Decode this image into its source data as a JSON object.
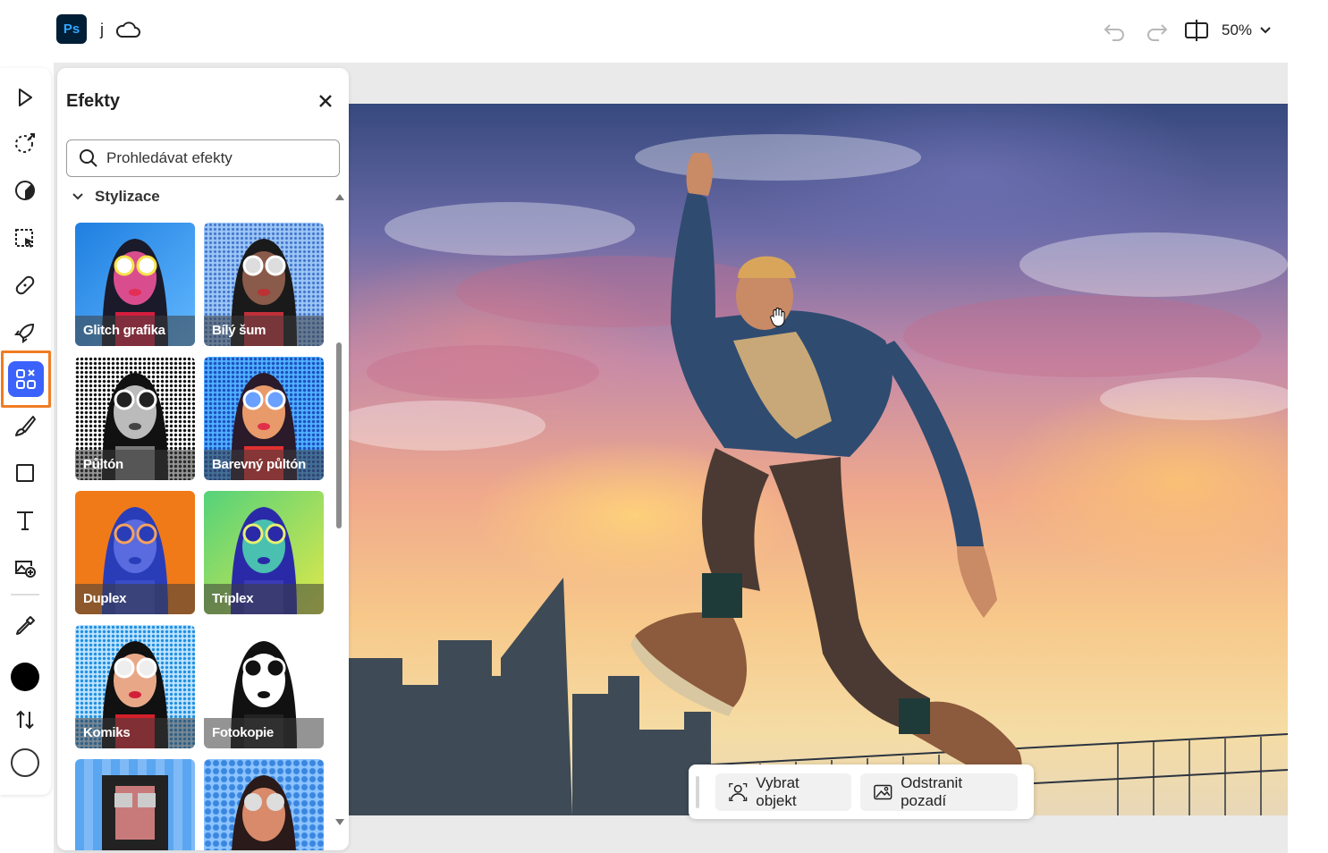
{
  "app": {
    "logo": "Ps",
    "document_name": "j"
  },
  "topbar": {
    "zoom": "50%"
  },
  "panel": {
    "title": "Efekty",
    "search_placeholder": "Prohledávat efekty",
    "section": "Stylizace",
    "effects": [
      {
        "label": "Glitch grafika"
      },
      {
        "label": "Bílý šum"
      },
      {
        "label": "Půltón"
      },
      {
        "label": "Barevný půltón"
      },
      {
        "label": "Duplex"
      },
      {
        "label": "Triplex"
      },
      {
        "label": "Komiks"
      },
      {
        "label": "Fotokopie"
      },
      {
        "label": ""
      },
      {
        "label": ""
      }
    ]
  },
  "action_bar": {
    "select_subject": "Vybrat objekt",
    "remove_background": "Odstranit pozadí"
  },
  "toolbar": {
    "tools": [
      "move-tool",
      "quick-select-tool",
      "adjust-tool",
      "selection-tool",
      "heal-tool",
      "quick-actions-tool",
      "effects-tool",
      "brush-tool",
      "shape-tool",
      "text-tool",
      "add-image-tool",
      "eyedropper-tool"
    ],
    "active_tool": "effects-tool",
    "foreground_color": "#000000",
    "background_color": "#ffffff"
  },
  "colors": {
    "accent": "#3b63fb",
    "highlight": "#ef7d23",
    "ps_brand": "#001e36"
  }
}
